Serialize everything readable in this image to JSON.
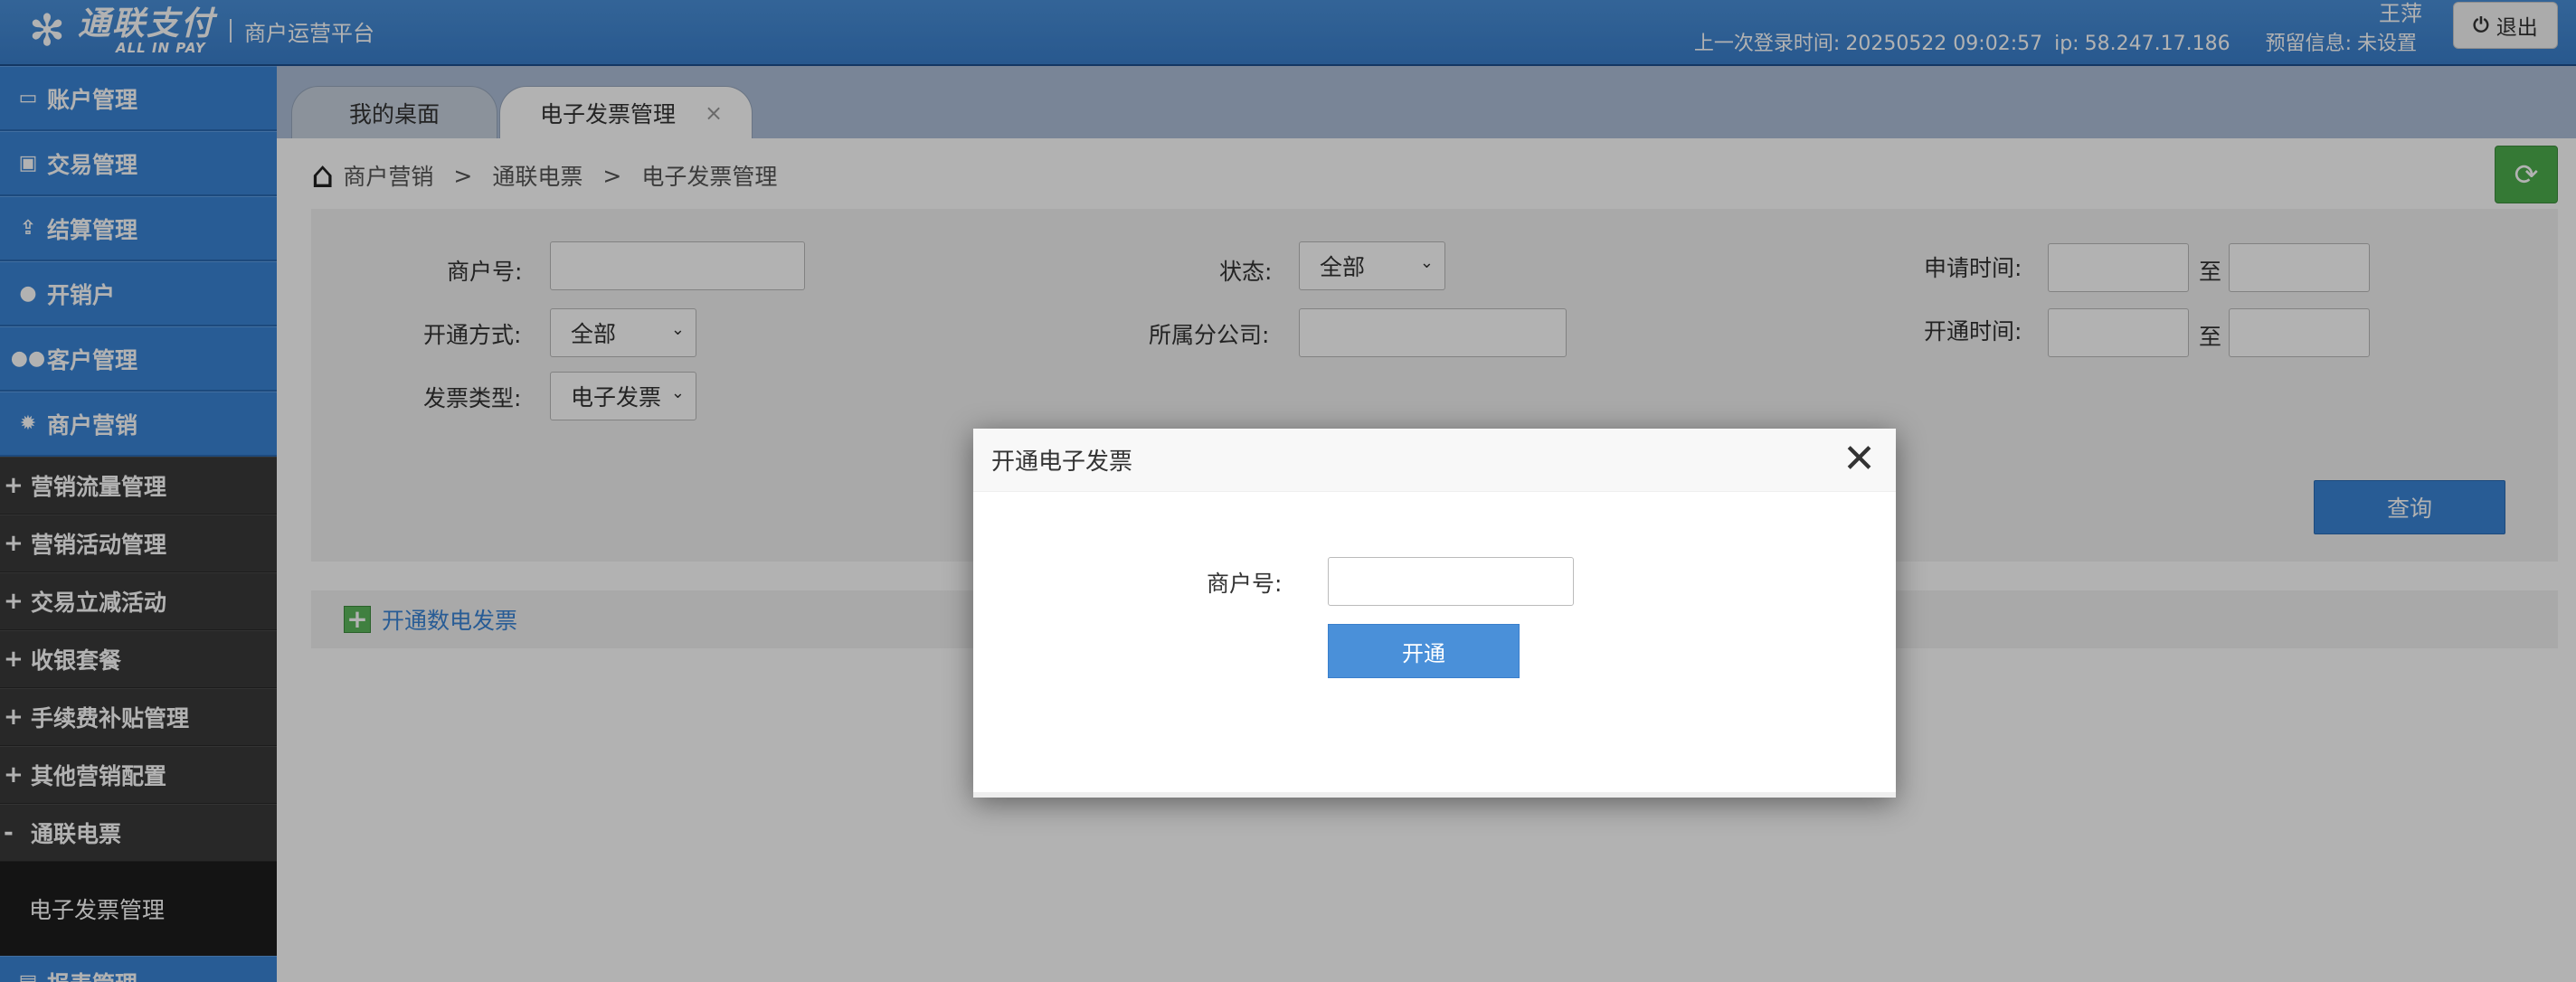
{
  "header": {
    "logo_cn": "通联支付",
    "logo_en": "ALL IN PAY",
    "platform": "商户运营平台",
    "user": "王萍",
    "last_login_label": "上一次登录时间:",
    "last_login_time": "20250522 09:02:57",
    "ip_label": "ip:",
    "ip": "58.247.17.186",
    "reserved_label": "预留信息:",
    "reserved_value": "未设置",
    "logout": "退出"
  },
  "sidebar": {
    "top_items": [
      {
        "label": "账户管理",
        "icon": "card-icon"
      },
      {
        "label": "交易管理",
        "icon": "cash-icon"
      },
      {
        "label": "结算管理",
        "icon": "upload-icon"
      },
      {
        "label": "开销户",
        "icon": "user-icon"
      },
      {
        "label": "客户管理",
        "icon": "users-icon"
      },
      {
        "label": "商户营销",
        "icon": "gear-icon"
      }
    ],
    "sub_items": [
      {
        "sign": "+",
        "label": "营销流量管理"
      },
      {
        "sign": "+",
        "label": "营销活动管理"
      },
      {
        "sign": "+",
        "label": "交易立减活动"
      },
      {
        "sign": "+",
        "label": "收银套餐"
      },
      {
        "sign": "+",
        "label": "手续费补贴管理"
      },
      {
        "sign": "+",
        "label": "其他营销配置"
      },
      {
        "sign": "-",
        "label": "通联电票"
      }
    ],
    "active_leaf": "电子发票管理",
    "partial_item": "报表管理"
  },
  "tabs": {
    "desktop": "我的桌面",
    "invoice": "电子发票管理",
    "close": "×"
  },
  "breadcrumb": {
    "level1": "商户营销",
    "level2": "通联电票",
    "level3": "电子发票管理",
    "sep": ">"
  },
  "filters": {
    "merchant_no": "商户号:",
    "status": "状态:",
    "status_value": "全部",
    "apply_time": "申请时间:",
    "to": "至",
    "open_method": "开通方式:",
    "open_method_value": "全部",
    "branch": "所属分公司:",
    "open_time": "开通时间:",
    "invoice_type": "发票类型:",
    "invoice_type_value": "电子发票",
    "query": "查询"
  },
  "action": {
    "open_digital": "开通数电发票"
  },
  "modal": {
    "title": "开通电子发票",
    "merchant_label": "商户号:",
    "submit": "开通"
  },
  "colors": {
    "brand_blue": "#3a85d6",
    "refresh_green": "#4cae4c"
  }
}
